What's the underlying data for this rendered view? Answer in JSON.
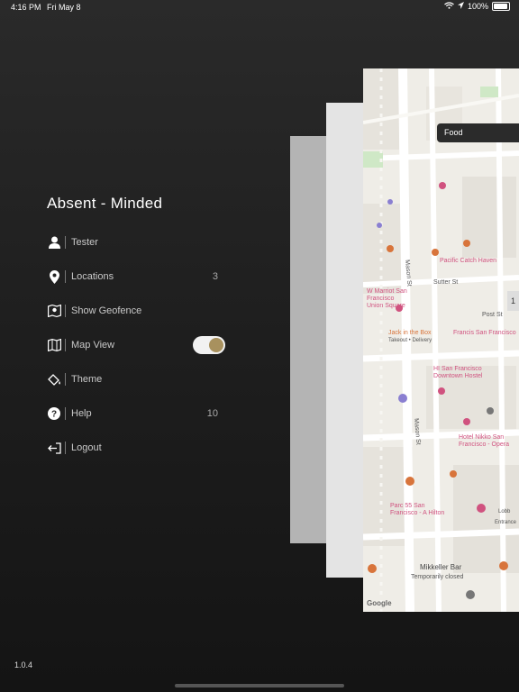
{
  "status_bar": {
    "time": "4:16 PM",
    "date": "Fri May 8",
    "battery": "100%"
  },
  "app_title": "Absent - Minded",
  "menu": {
    "items": [
      {
        "label": "Tester",
        "icon": "user-icon"
      },
      {
        "label": "Locations",
        "count": "3",
        "icon": "location-pin-icon"
      },
      {
        "label": "Show Geofence",
        "icon": "geofence-map-icon"
      },
      {
        "label": "Map View",
        "toggle": true,
        "icon": "map-icon"
      },
      {
        "label": "Theme",
        "icon": "paint-bucket-icon"
      },
      {
        "label": "Help",
        "count": "10",
        "icon": "question-icon"
      },
      {
        "label": "Logout",
        "icon": "logout-icon"
      }
    ]
  },
  "version": "1.0.4",
  "map": {
    "search_chip": "Food",
    "labels": {
      "mason_st": "Mason St",
      "sutter_st": "Sutter St",
      "post_st": "Post St",
      "pacific_catch": "Pacific Catch Haven",
      "jack_in_the_box": "Jack in the Box",
      "jack_sub": "Takeout • Delivery",
      "marriott": "W Marriot San Francisco Union Square",
      "hi_sf": "HI San Francisco Downtown Hostel",
      "nikko": "Hotel Nikko San Francisco - Opera",
      "parc55": "Parc 55 San Francisco - A Hilton",
      "mikkeller": "Mikkeller Bar",
      "mikkeller_status": "Temporarily closed",
      "francis": "Francis San Francisco",
      "google": "Google",
      "entrance": "Entrance",
      "lobby": "Lobb",
      "page_indicator": "1"
    }
  },
  "colors": {
    "accent": "#a8915e",
    "background_top": "#2a2a2a",
    "background_bottom": "#141414"
  }
}
